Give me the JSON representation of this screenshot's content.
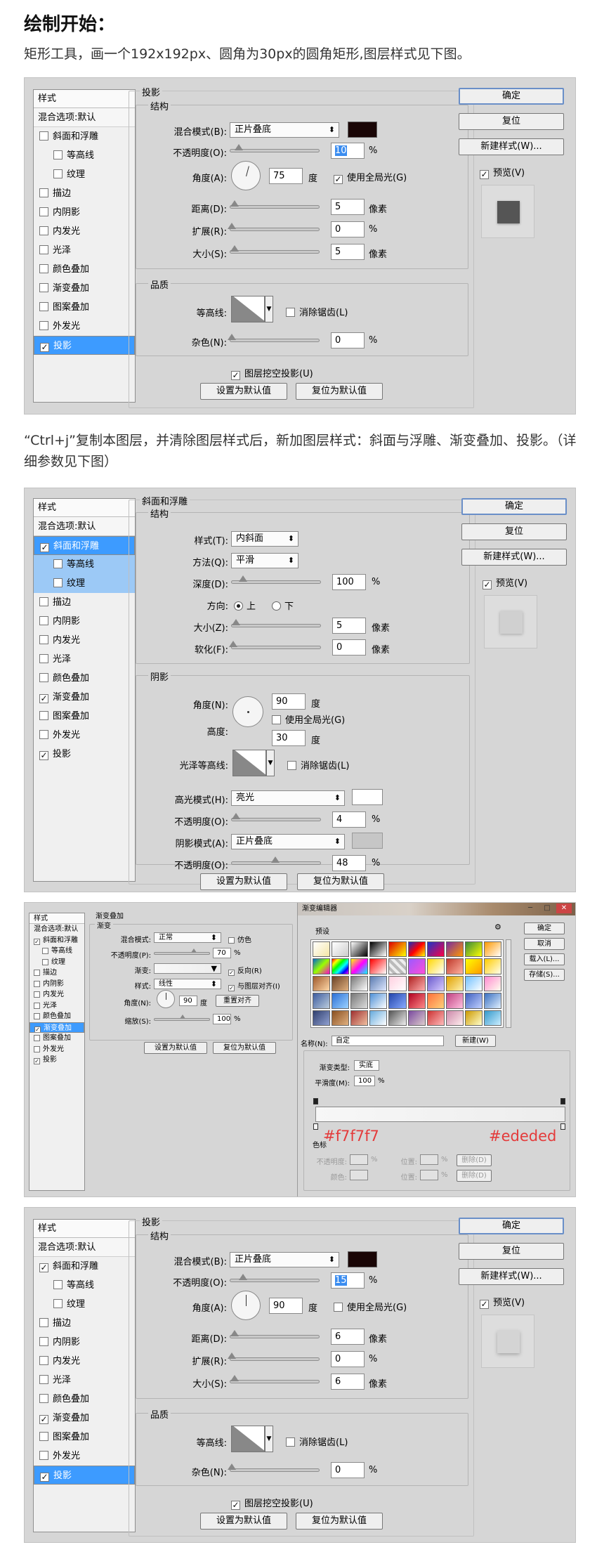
{
  "heading": "绘制开始：",
  "intro": "矩形工具，画一个192x192px、圆角为30px的圆角矩形,图层样式见下图。",
  "step2": "“Ctrl+j”复制本图层，并清除图层样式后，新加图层样式：斜面与浮雕、渐变叠加、投影。（详细参数见下图）",
  "common": {
    "styles": "样式",
    "blend_default": "混合选项:默认",
    "bevel": "斜面和浮雕",
    "contour": "等高线",
    "texture": "纹理",
    "stroke": "描边",
    "inner_shadow": "内阴影",
    "inner_glow": "内发光",
    "satin": "光泽",
    "color_overlay": "颜色叠加",
    "gradient_overlay": "渐变叠加",
    "pattern_overlay": "图案叠加",
    "outer_glow": "外发光",
    "drop_shadow": "投影",
    "ok": "确定",
    "reset": "复位",
    "new_style": "新建样式(W)...",
    "preview": "预览(V)",
    "make_default": "设置为默认值",
    "reset_default": "复位为默认值",
    "structure": "结构",
    "quality": "品质",
    "blend_mode": "混合模式(B):",
    "opacity": "不透明度(O):",
    "angle": "角度(A):",
    "degree": "度",
    "use_global": "使用全局光(G)",
    "distance": "距离(D):",
    "spread": "扩展(R):",
    "size": "大小(S):",
    "px": "像素",
    "pct": "%",
    "contour_lbl": "等高线:",
    "anti_alias": "消除锯齿(L)",
    "noise": "杂色(N):",
    "knockout": "图层挖空投影(U)",
    "multiply": "正片叠底"
  },
  "s1": {
    "title": "投影",
    "opacity": "10",
    "angle": "75",
    "distance": "5",
    "spread": "0",
    "size": "5",
    "noise": "0",
    "color": "#1a0606",
    "preview_color": "#555555"
  },
  "s2": {
    "title": "斜面和浮雕",
    "style_lbl": "样式(T):",
    "style": "内斜面",
    "method_lbl": "方法(Q):",
    "method": "平滑",
    "depth_lbl": "深度(D):",
    "depth": "100",
    "dir_lbl": "方向:",
    "up": "上",
    "down": "下",
    "size_lbl": "大小(Z):",
    "size": "5",
    "soften_lbl": "软化(F):",
    "soften": "0",
    "shading": "阴影",
    "angle_lbl": "角度(N):",
    "angle": "90",
    "altitude_lbl": "高度:",
    "altitude": "30",
    "gloss_lbl": "光泽等高线:",
    "hl_mode_lbl": "高光模式(H):",
    "hl_mode": "亮光",
    "hl_op": "4",
    "sh_mode_lbl": "阴影模式(A):",
    "sh_op": "48",
    "preview_color": "#d0d0d0"
  },
  "s3": {
    "title": "渐变叠加",
    "sub": "渐变",
    "blend_lbl": "混合模式:",
    "blend": "正常",
    "dither": "仿色",
    "op_lbl": "不透明度(P):",
    "op": "70",
    "grad_lbl": "渐变:",
    "reverse": "反向(R)",
    "style_lbl": "样式:",
    "style": "线性",
    "align": "与图层对齐(I)",
    "angle_lbl": "角度(N):",
    "angle": "90",
    "reset_align": "重置对齐",
    "scale_lbl": "缩放(S):",
    "scale": "100",
    "ge_title": "渐变编辑器",
    "presets": "预设",
    "ok": "确定",
    "cancel": "取消",
    "load": "载入(L)...",
    "save": "存储(S)...",
    "name_lbl": "名称(N):",
    "name": "自定",
    "new": "新建(W)",
    "type_lbl": "渐变类型:",
    "type": "实底",
    "smooth_lbl": "平滑度(M):",
    "smooth": "100",
    "stops": "色标",
    "op2_lbl": "不透明度:",
    "loc_lbl": "位置:",
    "del": "删除(D)",
    "color_lbl": "颜色:",
    "c_left": "#f7f7f7",
    "c_right": "#ededed"
  },
  "s4": {
    "title": "投影",
    "opacity": "15",
    "angle": "90",
    "distance": "6",
    "spread": "0",
    "size": "6",
    "noise": "0",
    "color": "#1a0606",
    "preview_color": "#d4d4d4"
  }
}
